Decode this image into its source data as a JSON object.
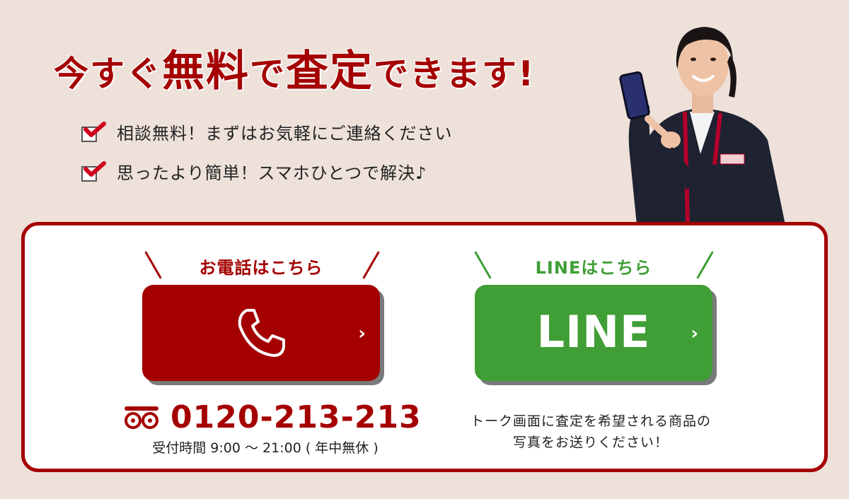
{
  "headline": {
    "part1": "今すぐ",
    "part2": "無料",
    "part3": "で",
    "part4": "査定",
    "part5": "できます!"
  },
  "checklist": [
    {
      "text": "相談無料！まずはお気軽にご連絡ください"
    },
    {
      "text": "思ったより簡単！スマホひとつで解決♪"
    }
  ],
  "phone": {
    "heading": "お電話はこちら",
    "number": "0120-213-213",
    "hours": "受付時間 9:00 ～ 21:00 ( 年中無休 )",
    "icon": "phone-handset-icon",
    "color": "#a50000"
  },
  "line": {
    "heading": "LINEはこちら",
    "button_label": "LINE",
    "note_line1": "トーク画面に査定を希望される商品の",
    "note_line2": "写真をお送りください！",
    "color": "#3f9e36"
  },
  "colors": {
    "background": "#ede1da",
    "brand_red": "#a50000",
    "line_green": "#3f9e36"
  }
}
